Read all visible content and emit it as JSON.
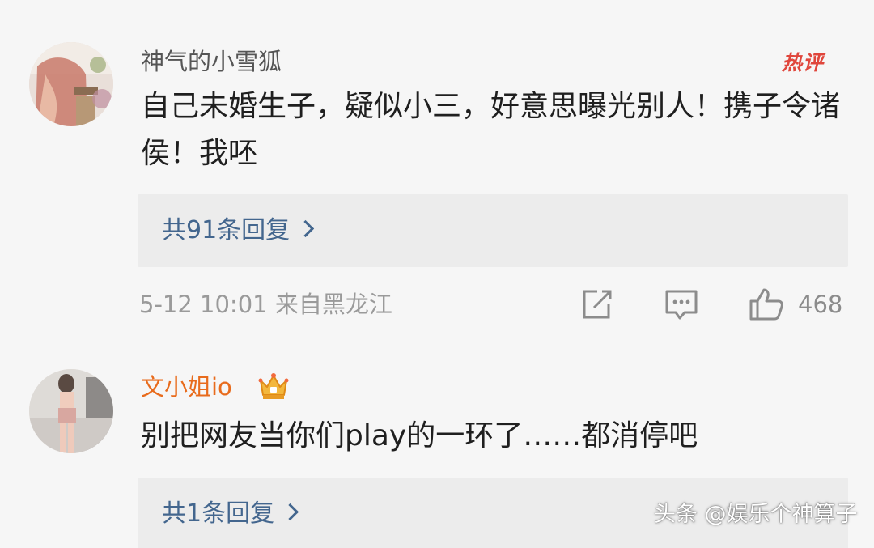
{
  "comments": [
    {
      "username": "神气的小雪狐",
      "badge": "热评",
      "content": "自己未婚生子，疑似小三，好意思曝光别人！携子令诸侯！我呸",
      "reply_label": "共91条回复",
      "meta": "5-12 10:01 来自黑龙江",
      "likes": "468"
    },
    {
      "username": "文小姐io",
      "content": "别把网友当你们play的一环了……都消停吧",
      "reply_label": "共1条回复"
    }
  ],
  "watermark": "头条 @娱乐个神算子",
  "colors": {
    "username_gray": "#555555",
    "username_vip": "#e86b1c",
    "reply_link": "#43668e",
    "hot_badge": "#e0463c"
  }
}
